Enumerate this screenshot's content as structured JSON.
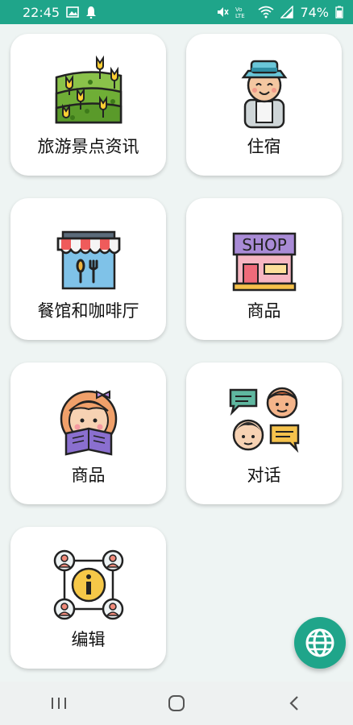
{
  "status_bar": {
    "time": "22:45",
    "battery": "74%",
    "icons": [
      "image-icon",
      "notification-icon",
      "mute-icon",
      "volte-icon",
      "wifi-icon",
      "signal-icon",
      "battery-icon"
    ]
  },
  "cards": [
    {
      "label": "旅游景点资讯",
      "icon": "tulip-field-icon"
    },
    {
      "label": "住宿",
      "icon": "traveler-icon"
    },
    {
      "label": "餐馆和咖啡厅",
      "icon": "restaurant-awning-icon"
    },
    {
      "label": "商品",
      "icon": "shop-icon"
    },
    {
      "label": "商品",
      "icon": "girl-reading-icon"
    },
    {
      "label": "对话",
      "icon": "conversation-icon"
    },
    {
      "label": "编辑",
      "icon": "info-network-icon"
    }
  ],
  "fab": {
    "icon": "globe-icon"
  },
  "nav_bar": {
    "icons": [
      "recent-apps-icon",
      "home-icon",
      "back-icon"
    ]
  },
  "colors": {
    "accent": "#1fa58a",
    "background": "#eef4f3",
    "card": "#ffffff"
  }
}
